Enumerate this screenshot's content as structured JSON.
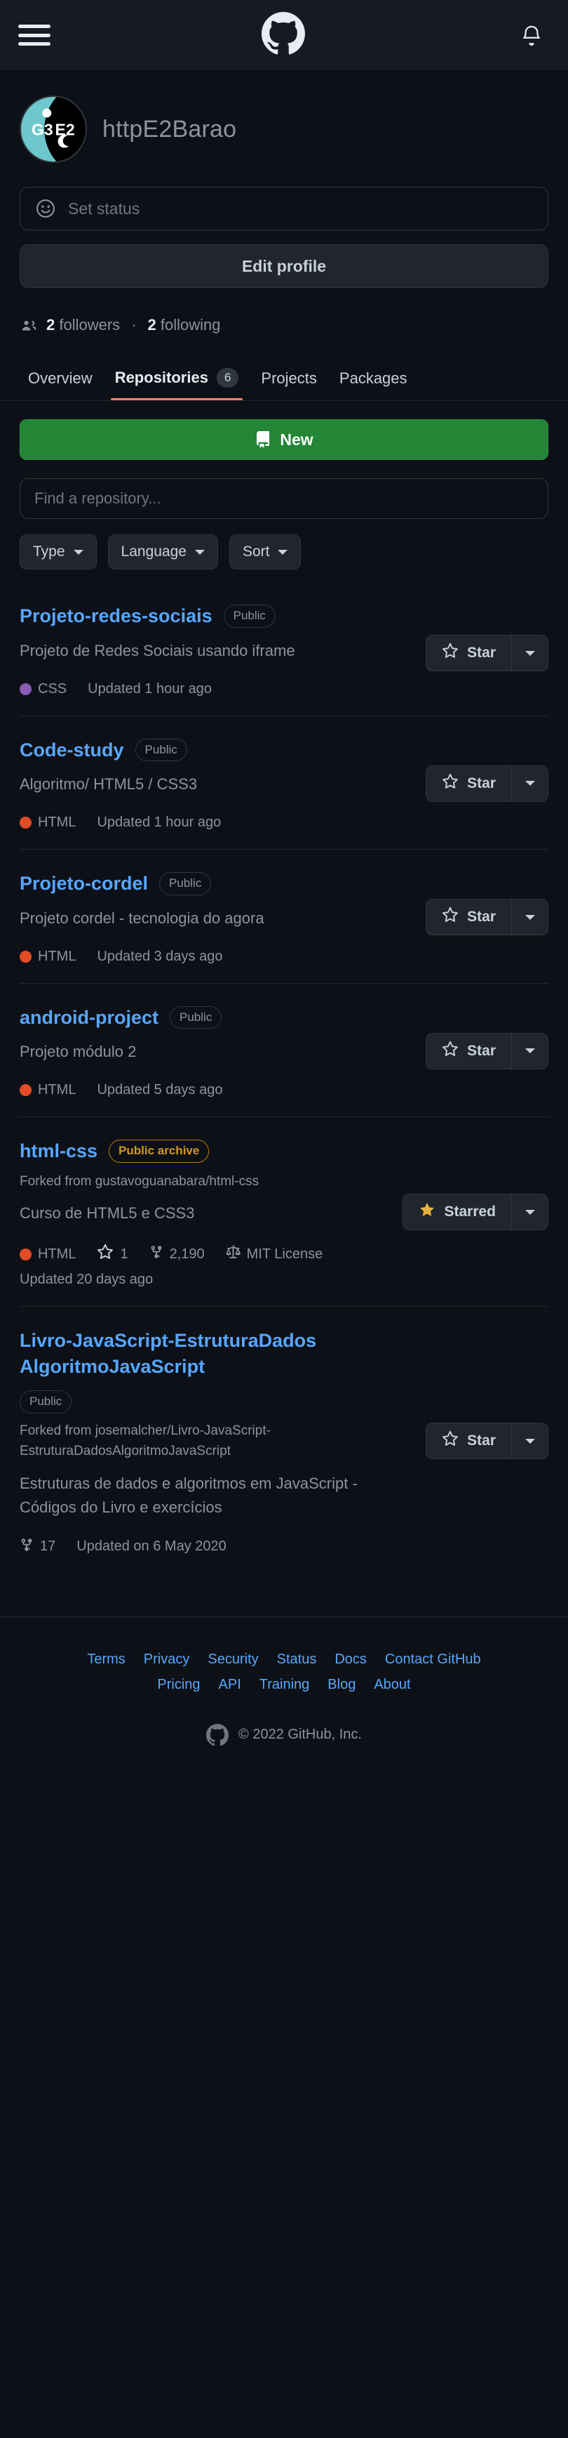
{
  "header": {
    "menu_label": "Menu",
    "logo_label": "GitHub",
    "notifications_label": "Notifications"
  },
  "profile": {
    "username": "httpE2Barao",
    "avatar_label": "G3E2",
    "status_placeholder": "Set status",
    "edit_profile_label": "Edit profile",
    "followers_count": "2",
    "followers_label": "followers",
    "separator": "·",
    "following_count": "2",
    "following_label": "following"
  },
  "tabs": [
    {
      "label": "Overview",
      "count": null,
      "active": false
    },
    {
      "label": "Repositories",
      "count": "6",
      "active": true
    },
    {
      "label": "Projects",
      "count": null,
      "active": false
    },
    {
      "label": "Packages",
      "count": null,
      "active": false
    }
  ],
  "toolbar": {
    "new_label": "New",
    "search_placeholder": "Find a repository...",
    "filters": [
      {
        "label": "Type"
      },
      {
        "label": "Language"
      },
      {
        "label": "Sort"
      }
    ]
  },
  "repos": [
    {
      "name": "Projeto-redes-sociais",
      "badge": "Public",
      "badge_kind": "public",
      "fork_from": null,
      "description": "Projeto de Redes Sociais usando iframe",
      "language": "CSS",
      "language_color": "#8a5bb4",
      "stars": null,
      "forks": null,
      "license": null,
      "updated": "Updated 1 hour ago",
      "updated_inline": true,
      "star_label": "Star",
      "starred": false
    },
    {
      "name": "Code-study",
      "badge": "Public",
      "badge_kind": "public",
      "fork_from": null,
      "description": "Algoritmo/ HTML5 / CSS3",
      "language": "HTML",
      "language_color": "#e34c26",
      "stars": null,
      "forks": null,
      "license": null,
      "updated": "Updated 1 hour ago",
      "updated_inline": true,
      "star_label": "Star",
      "starred": false
    },
    {
      "name": "Projeto-cordel",
      "badge": "Public",
      "badge_kind": "public",
      "fork_from": null,
      "description": "Projeto cordel - tecnologia do agora",
      "language": "HTML",
      "language_color": "#e34c26",
      "stars": null,
      "forks": null,
      "license": null,
      "updated": "Updated 3 days ago",
      "updated_inline": true,
      "star_label": "Star",
      "starred": false
    },
    {
      "name": "android-project",
      "badge": "Public",
      "badge_kind": "public",
      "fork_from": null,
      "description": "Projeto módulo 2",
      "language": "HTML",
      "language_color": "#e34c26",
      "stars": null,
      "forks": null,
      "license": null,
      "updated": "Updated 5 days ago",
      "updated_inline": true,
      "star_label": "Star",
      "starred": false
    },
    {
      "name": "html-css",
      "badge": "Public archive",
      "badge_kind": "archive",
      "fork_from": "Forked from gustavoguanabara/html-css",
      "description": "Curso de HTML5 e CSS3",
      "language": "HTML",
      "language_color": "#e34c26",
      "stars": "1",
      "forks": "2,190",
      "license": "MIT License",
      "updated": "Updated 20 days ago",
      "updated_inline": false,
      "star_label": "Starred",
      "starred": true
    },
    {
      "name": "Livro-JavaScript-EstruturaDados AlgoritmoJavaScript",
      "badge": "Public",
      "badge_kind": "public",
      "fork_from": "Forked from josemalcher/Livro-JavaScript-EstruturaDadosAlgoritmoJavaScript",
      "description": "Estruturas de dados e algoritmos em JavaScript - Códigos do Livro e exercícios",
      "language": null,
      "language_color": null,
      "stars": null,
      "forks": "17",
      "license": null,
      "updated": "Updated on 6 May 2020",
      "updated_inline": true,
      "star_label": "Star",
      "starred": false
    }
  ],
  "footer": {
    "links_row1": [
      "Terms",
      "Privacy",
      "Security",
      "Status",
      "Docs",
      "Contact GitHub"
    ],
    "links_row2": [
      "Pricing",
      "API",
      "Training",
      "Blog",
      "About"
    ],
    "copyright": "© 2022 GitHub, Inc."
  },
  "colors": {
    "background": "#0d1117",
    "header_bg": "#161b22",
    "accent_green": "#238636",
    "link_blue": "#58a6ff",
    "tab_underline": "#f78166",
    "archive_yellow": "#d29922",
    "star_yellow": "#e3b341"
  }
}
